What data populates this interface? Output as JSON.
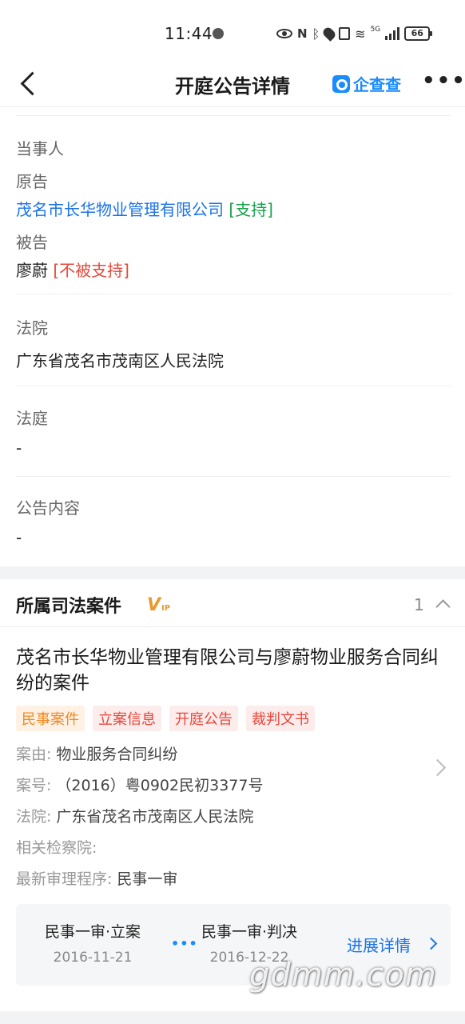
{
  "status_bar": {
    "time": "11:44",
    "battery": "66",
    "network": "5G"
  },
  "nav": {
    "title": "开庭公告详情",
    "brand": "企查查"
  },
  "parties": {
    "heading": "当事人",
    "plaintiff_label": "原告",
    "plaintiff_name": "茂名市长华物业管理有限公司",
    "plaintiff_tag": "[支持]",
    "defendant_label": "被告",
    "defendant_name": "廖蔚",
    "defendant_tag": "[不被支持]"
  },
  "court": {
    "label": "法院",
    "value": "广东省茂名市茂南区人民法院"
  },
  "courtroom": {
    "label": "法庭",
    "value": "-"
  },
  "content": {
    "label": "公告内容",
    "value": "-"
  },
  "case_section": {
    "title": "所属司法案件",
    "vip": "V",
    "vip_sub": "IP",
    "count": "1",
    "case_title": "茂名市长华物业管理有限公司与廖蔚物业服务合同纠纷的案件",
    "tags": [
      "民事案件",
      "立案信息",
      "开庭公告",
      "裁判文书"
    ],
    "rows": [
      {
        "label": "案由:",
        "value": "物业服务合同纠纷"
      },
      {
        "label": "案号:",
        "value": "（2016）粤0902民初3377号"
      },
      {
        "label": "法院:",
        "value": "广东省茂名市茂南区人民法院"
      },
      {
        "label": "相关检察院:",
        "value": ""
      },
      {
        "label": "最新审理程序:",
        "value": "民事一审"
      }
    ],
    "progress": {
      "stage1_name": "民事一审·立案",
      "stage1_date": "2016-11-21",
      "stage2_name": "民事一审·判决",
      "stage2_date": "2016-12-22",
      "dots": "•••",
      "detail_link": "进展详情"
    }
  },
  "watermark": "gdmm.com"
}
